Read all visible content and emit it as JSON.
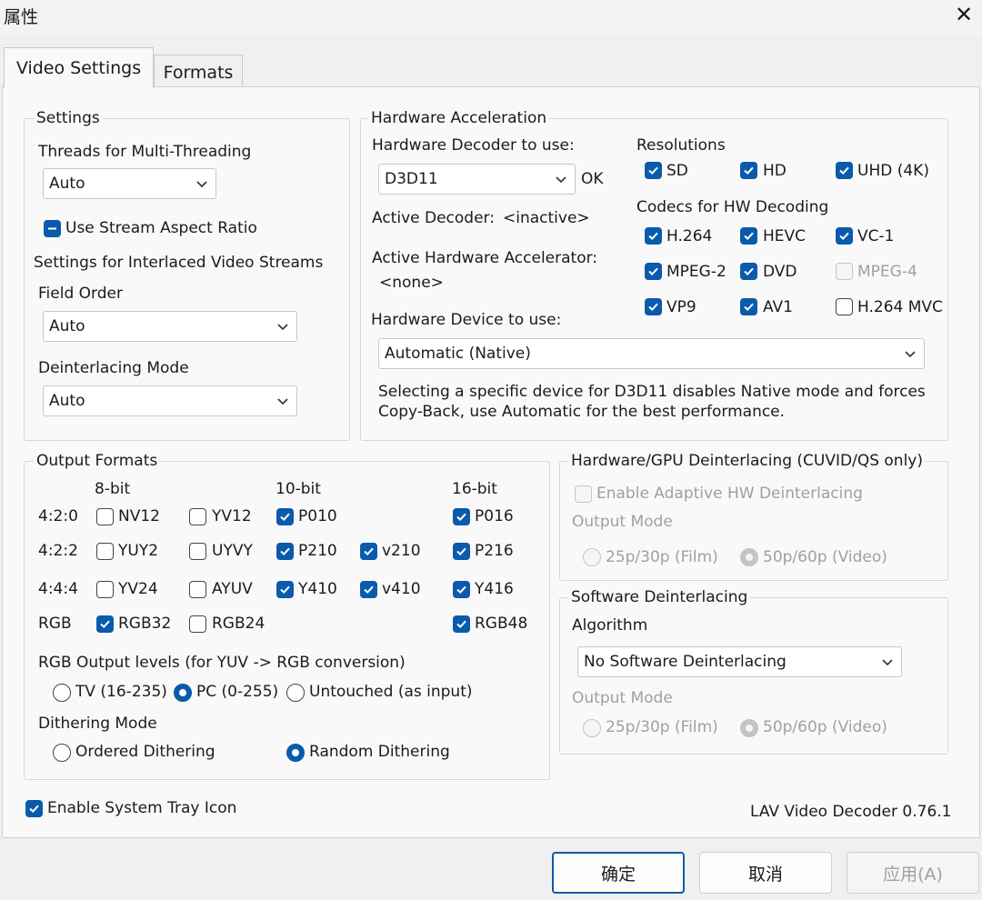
{
  "window": {
    "title": "属性"
  },
  "tabs": [
    {
      "label": "Video Settings",
      "active": true
    },
    {
      "label": "Formats",
      "active": false
    }
  ],
  "settings": {
    "group_label": "Settings",
    "threads_label": "Threads for Multi-Threading",
    "threads_value": "Auto",
    "stream_aspect_label": "Use Stream Aspect Ratio",
    "interlaced_label": "Settings for Interlaced Video Streams",
    "field_order_label": "Field Order",
    "field_order_value": "Auto",
    "deint_mode_label": "Deinterlacing Mode",
    "deint_mode_value": "Auto"
  },
  "hw": {
    "group_label": "Hardware Acceleration",
    "decoder_label": "Hardware Decoder to use:",
    "decoder_value": "D3D11",
    "decoder_status": "OK",
    "active_decoder_label": "Active Decoder:",
    "active_decoder_value": "<inactive>",
    "active_accel_label": "Active Hardware Accelerator:",
    "active_accel_value": "<none>",
    "device_label": "Hardware Device to use:",
    "device_value": "Automatic (Native)",
    "note_line1": "Selecting a specific device for D3D11 disables Native mode and forces",
    "note_line2": "Copy-Back, use Automatic for the best performance.",
    "resolutions_label": "Resolutions",
    "resolutions": [
      {
        "label": "SD",
        "checked": true
      },
      {
        "label": "HD",
        "checked": true
      },
      {
        "label": "UHD (4K)",
        "checked": true
      }
    ],
    "codecs_label": "Codecs for HW Decoding",
    "codecs": [
      {
        "label": "H.264",
        "checked": true
      },
      {
        "label": "HEVC",
        "checked": true
      },
      {
        "label": "VC-1",
        "checked": true
      },
      {
        "label": "MPEG-2",
        "checked": true
      },
      {
        "label": "DVD",
        "checked": true
      },
      {
        "label": "MPEG-4",
        "checked": false,
        "disabled": true
      },
      {
        "label": "VP9",
        "checked": true
      },
      {
        "label": "AV1",
        "checked": true
      },
      {
        "label": "H.264 MVC",
        "checked": false
      }
    ]
  },
  "output": {
    "group_label": "Output Formats",
    "col_8bit": "8-bit",
    "col_10bit": "10-bit",
    "col_16bit": "16-bit",
    "rows": [
      {
        "label": "4:2:0",
        "items": [
          {
            "label": "NV12",
            "checked": false
          },
          {
            "label": "YV12",
            "checked": false
          },
          {
            "label": "P010",
            "checked": true
          },
          {
            "label": "P016",
            "checked": true
          }
        ]
      },
      {
        "label": "4:2:2",
        "items": [
          {
            "label": "YUY2",
            "checked": false
          },
          {
            "label": "UYVY",
            "checked": false
          },
          {
            "label": "P210",
            "checked": true
          },
          {
            "label": "v210",
            "checked": true
          },
          {
            "label": "P216",
            "checked": true
          }
        ]
      },
      {
        "label": "4:4:4",
        "items": [
          {
            "label": "YV24",
            "checked": false
          },
          {
            "label": "AYUV",
            "checked": false
          },
          {
            "label": "Y410",
            "checked": true
          },
          {
            "label": "v410",
            "checked": true
          },
          {
            "label": "Y416",
            "checked": true
          }
        ]
      },
      {
        "label": "RGB",
        "items": [
          {
            "label": "RGB32",
            "checked": true
          },
          {
            "label": "RGB24",
            "checked": false
          },
          {
            "label": "RGB48",
            "checked": true
          }
        ]
      }
    ],
    "rgb_levels_label": "RGB Output levels (for YUV -> RGB conversion)",
    "rgb_levels": [
      {
        "label": "TV (16-235)",
        "selected": false
      },
      {
        "label": "PC (0-255)",
        "selected": true
      },
      {
        "label": "Untouched (as input)",
        "selected": false
      }
    ],
    "dithering_label": "Dithering Mode",
    "dithering": [
      {
        "label": "Ordered Dithering",
        "selected": false
      },
      {
        "label": "Random Dithering",
        "selected": true
      }
    ]
  },
  "hwdeint": {
    "group_label": "Hardware/GPU Deinterlacing (CUVID/QS only)",
    "enable_label": "Enable Adaptive HW Deinterlacing",
    "output_mode_label": "Output Mode",
    "options": [
      {
        "label": "25p/30p (Film)",
        "selected": false
      },
      {
        "label": "50p/60p (Video)",
        "selected": true
      }
    ]
  },
  "swdeint": {
    "group_label": "Software Deinterlacing",
    "algorithm_label": "Algorithm",
    "algorithm_value": "No Software Deinterlacing",
    "output_mode_label": "Output Mode",
    "options": [
      {
        "label": "25p/30p (Film)",
        "selected": false
      },
      {
        "label": "50p/60p (Video)",
        "selected": true
      }
    ]
  },
  "footer": {
    "tray_label": "Enable System Tray Icon",
    "version": "LAV Video Decoder 0.76.1"
  },
  "buttons": {
    "ok": "确定",
    "cancel": "取消",
    "apply": "应用(A)"
  },
  "colors": {
    "accent": "#0a5bab",
    "background": "#f0f0f0",
    "panel": "#f9f9f9"
  }
}
